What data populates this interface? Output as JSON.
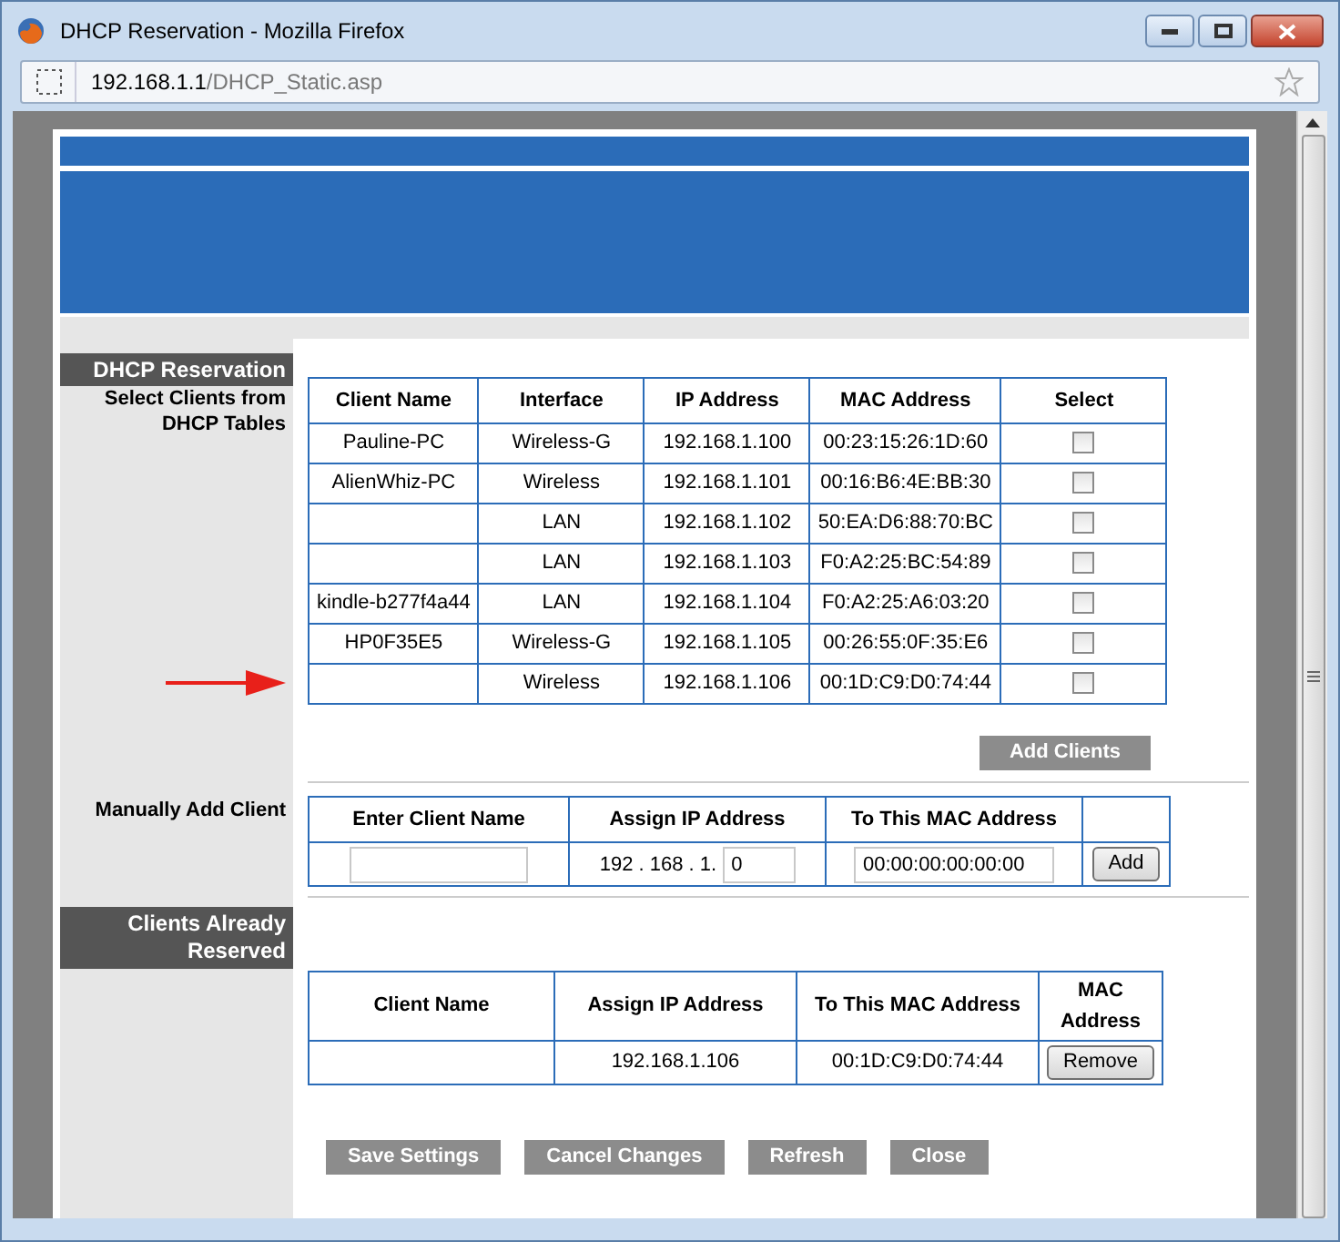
{
  "window": {
    "title": "DHCP Reservation - Mozilla Firefox",
    "url_host": "192.168.1.1",
    "url_path": "/DHCP_Static.asp"
  },
  "reservation": {
    "heading": "DHCP Reservation",
    "subheading": "Select Clients from DHCP Tables",
    "columns": [
      "Client Name",
      "Interface",
      "IP Address",
      "MAC Address",
      "Select"
    ],
    "rows": [
      {
        "name": "Pauline-PC",
        "interface": "Wireless-G",
        "ip": "192.168.1.100",
        "mac": "00:23:15:26:1D:60",
        "checked": false
      },
      {
        "name": "AlienWhiz-PC",
        "interface": "Wireless",
        "ip": "192.168.1.101",
        "mac": "00:16:B6:4E:BB:30",
        "checked": false
      },
      {
        "name": "",
        "interface": "LAN",
        "ip": "192.168.1.102",
        "mac": "50:EA:D6:88:70:BC",
        "checked": false
      },
      {
        "name": "",
        "interface": "LAN",
        "ip": "192.168.1.103",
        "mac": "F0:A2:25:BC:54:89",
        "checked": false
      },
      {
        "name": "kindle-b277f4a44",
        "interface": "LAN",
        "ip": "192.168.1.104",
        "mac": "F0:A2:25:A6:03:20",
        "checked": false
      },
      {
        "name": "HP0F35E5",
        "interface": "Wireless-G",
        "ip": "192.168.1.105",
        "mac": "00:26:55:0F:35:E6",
        "checked": false
      },
      {
        "name": "",
        "interface": "Wireless",
        "ip": "192.168.1.106",
        "mac": "00:1D:C9:D0:74:44",
        "checked": false
      }
    ],
    "add_button": "Add Clients"
  },
  "manual": {
    "heading": "Manually Add Client",
    "columns": [
      "Enter Client Name",
      "Assign IP Address",
      "To This MAC Address"
    ],
    "ip_prefix": "192 . 168 . 1.",
    "ip_last": "0",
    "mac": "00:00:00:00:00:00",
    "add_button": "Add"
  },
  "reserved": {
    "heading": "Clients Already Reserved",
    "columns": [
      "Client Name",
      "Assign IP Address",
      "To This MAC Address",
      "MAC Address"
    ],
    "rows": [
      {
        "name": "",
        "ip": "192.168.1.106",
        "mac": "00:1D:C9:D0:74:44",
        "button": "Remove"
      }
    ]
  },
  "buttons": [
    "Save Settings",
    "Cancel Changes",
    "Refresh",
    "Close"
  ]
}
